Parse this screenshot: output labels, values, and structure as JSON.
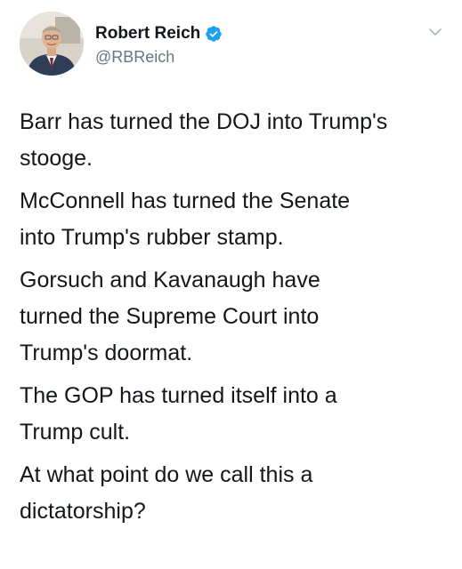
{
  "author": {
    "display_name": "Robert Reich",
    "handle": "@RBReich",
    "verified": true,
    "avatar": "profile-photo"
  },
  "icons": {
    "verified": "verified-badge-icon",
    "menu": "chevron-down-icon"
  },
  "colors": {
    "verified_blue": "#1da1f2",
    "text": "#14171a",
    "secondary_text": "#657786"
  },
  "tweet": {
    "paragraphs": [
      "Barr has turned the DOJ into Trump's\nstooge.",
      "McConnell has turned the Senate\ninto Trump's rubber stamp.",
      "Gorsuch and Kavanaugh have\nturned the Supreme Court into\nTrump's doormat.",
      "The GOP has turned itself into a\nTrump cult.",
      "At what point do we call this a\ndictatorship?"
    ]
  }
}
